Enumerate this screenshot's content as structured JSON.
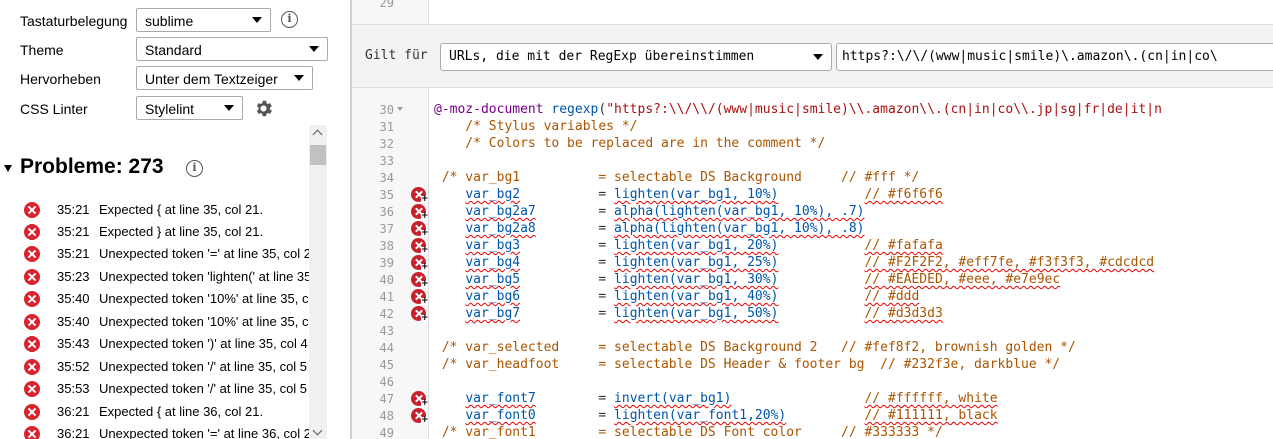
{
  "options": [
    {
      "label": "Tastaturbelegung",
      "value": "sublime"
    },
    {
      "label": "Theme",
      "value": "Standard"
    },
    {
      "label": "Hervorheben",
      "value": "Unter dem Textzeiger"
    },
    {
      "label": "CSS Linter",
      "value": "Stylelint"
    }
  ],
  "problems": {
    "title": "Probleme: 273",
    "items": [
      {
        "pos": "35:21",
        "msg": "Expected { at line 35, col 21."
      },
      {
        "pos": "35:21",
        "msg": "Expected } at line 35, col 21."
      },
      {
        "pos": "35:21",
        "msg": "Unexpected token '=' at line 35, col 2"
      },
      {
        "pos": "35:23",
        "msg": "Unexpected token 'lighten(' at line 35"
      },
      {
        "pos": "35:40",
        "msg": "Unexpected token '10%' at line 35, c"
      },
      {
        "pos": "35:40",
        "msg": "Unexpected token '10%' at line 35, c"
      },
      {
        "pos": "35:43",
        "msg": "Unexpected token ')' at line 35, col 4"
      },
      {
        "pos": "35:52",
        "msg": "Unexpected token '/' at line 35, col 5"
      },
      {
        "pos": "35:53",
        "msg": "Unexpected token '/' at line 35, col 5"
      },
      {
        "pos": "36:21",
        "msg": "Expected { at line 36, col 21."
      },
      {
        "pos": "36:21",
        "msg": "Unexpected token '=' at line 36, col 2"
      }
    ]
  },
  "editor": {
    "top_line_number": "29",
    "applies": {
      "label": "Gilt für",
      "type": "URLs, die mit der RegExp übereinstimmen",
      "value": "https?:\\/\\/(www|music|smile)\\.amazon\\.(cn|in|co\\"
    }
  },
  "code_lines": [
    {
      "n": "30",
      "fold": true,
      "error": false
    },
    {
      "n": "31",
      "error": false
    },
    {
      "n": "32",
      "error": false
    },
    {
      "n": "33",
      "error": false
    },
    {
      "n": "34",
      "error": false
    },
    {
      "n": "35",
      "error": true
    },
    {
      "n": "36",
      "error": true
    },
    {
      "n": "37",
      "error": true
    },
    {
      "n": "38",
      "error": true
    },
    {
      "n": "39",
      "error": true
    },
    {
      "n": "40",
      "error": true
    },
    {
      "n": "41",
      "error": true
    },
    {
      "n": "42",
      "error": true
    },
    {
      "n": "43",
      "error": false
    },
    {
      "n": "44",
      "error": false
    },
    {
      "n": "45",
      "error": false
    },
    {
      "n": "46",
      "error": false
    },
    {
      "n": "47",
      "error": true
    },
    {
      "n": "48",
      "error": true
    },
    {
      "n": "49",
      "error": false
    }
  ],
  "code": {
    "l30_kw": "@-moz-document",
    "l30_fn": "regexp",
    "l30_paren": "(",
    "l30_str": "\"https?:\\\\/\\\\/(www|music|smile)\\\\.amazon\\\\.(cn|in|co\\\\.jp|sg|fr|de|it|n",
    "l31": "    /* Stylus variables */",
    "l32": "    /* Colors to be replaced are in the comment */",
    "l34": " /* var_bg1          = selectable DS Background     // #fff */",
    "l35_v": "var_bg2",
    "l35_fn": "lighten(var_bg1, 10%)",
    "l35_c": "// #f6f6f6",
    "l36_v": "var_bg2a7",
    "l36_fn": "alpha(lighten(var_bg1, 10%), .7)",
    "l37_v": "var_bg2a8",
    "l37_fn": "alpha(lighten(var_bg1, 10%), .8)",
    "l38_v": "var_bg3",
    "l38_fn": "lighten(var_bg1, 20%)",
    "l38_c": "// #fafafa",
    "l39_v": "var_bg4",
    "l39_fn": "lighten(var_bg1, 25%)",
    "l39_c": "// #F2F2F2, #eff7fe, #f3f3f3, #cdcdcd",
    "l40_v": "var_bg5",
    "l40_fn": "lighten(var_bg1, 30%)",
    "l40_c": "// #EAEDED, #eee, #e7e9ec",
    "l41_v": "var_bg6",
    "l41_fn": "lighten(var_bg1, 40%)",
    "l41_c": "// #ddd",
    "l42_v": "var_bg7",
    "l42_fn": "lighten(var_bg1, 50%)",
    "l42_c": "// #d3d3d3",
    "l44": " /* var_selected     = selectable DS Background 2   // #fef8f2, brownish golden */",
    "l45": " /* var_headfoot     = selectable DS Header & footer bg  // #232f3e, darkblue */",
    "l47_v": "var_font7",
    "l47_fn": "invert(var_bg1)",
    "l47_c": "// #ffffff, white",
    "l48_v": "var_font0",
    "l48_fn": "lighten(var_font1,20%)",
    "l48_c": "// #111111, black",
    "l49": " /* var_font1        = selectable DS Font color     // #333333 */",
    "eq": "="
  }
}
